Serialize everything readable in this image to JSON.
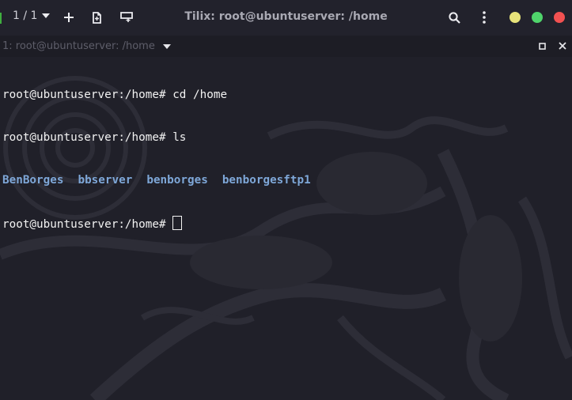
{
  "header": {
    "session_count": "1 / 1",
    "title": "Tilix: root@ubuntuserver: /home"
  },
  "icons": {
    "dropdown": "chevron-down-icon",
    "add": "plus-icon",
    "split_right": "add-terminal-right-icon",
    "split_down": "add-terminal-down-icon",
    "search": "search-icon",
    "menu": "kebab-menu-icon",
    "minimize": "minimize-dot-icon",
    "maximize": "maximize-dot-icon",
    "close": "close-dot-icon"
  },
  "colors": {
    "minimize": "#e7e37a",
    "maximize": "#4fd46b",
    "close": "#f25151",
    "directory": "#7ea7d8",
    "accent_edge": "#3fae3f"
  },
  "terminal_bar": {
    "title": "1: root@ubuntuserver: /home"
  },
  "terminal": {
    "lines": [
      {
        "prompt": "root@ubuntuserver:/home#",
        "command": " cd /home"
      },
      {
        "prompt": "root@ubuntuserver:/home#",
        "command": " ls"
      },
      {
        "prompt": "root@ubuntuserver:/home#",
        "command": " "
      }
    ],
    "ls_output": [
      "BenBorges",
      "bbserver",
      "benborges",
      "benborgesftp1"
    ]
  }
}
